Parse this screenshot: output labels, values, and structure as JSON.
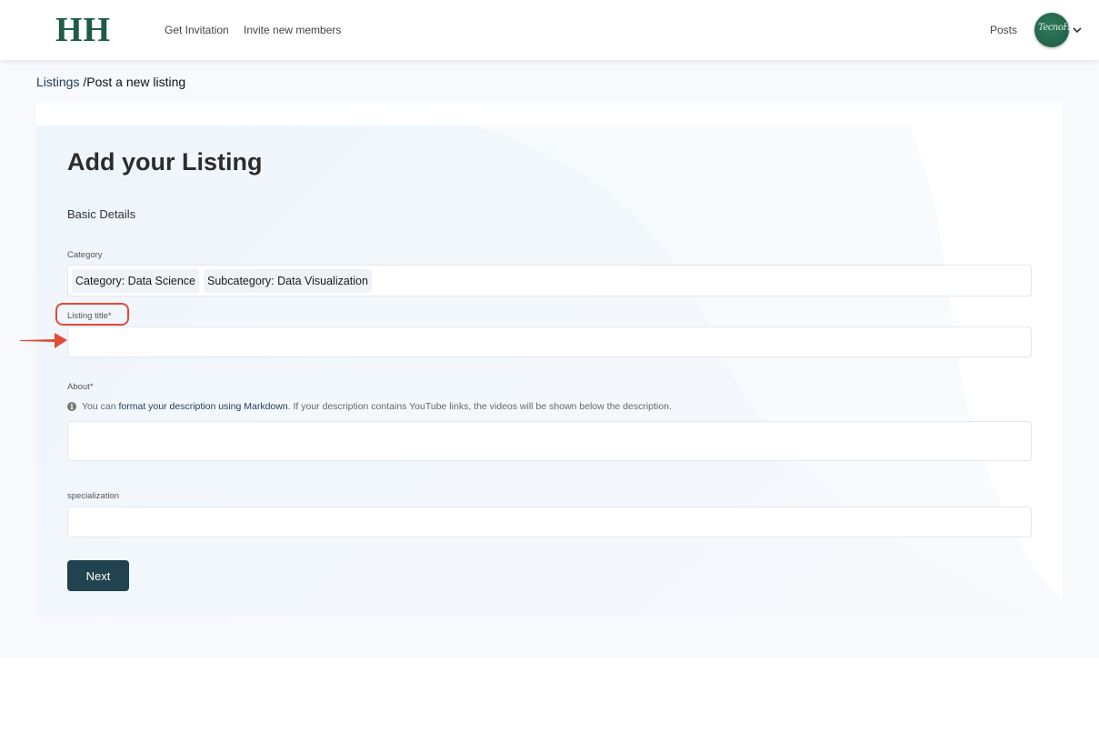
{
  "header": {
    "logo_text": "HH",
    "nav": [
      {
        "label": "Get Invitation"
      },
      {
        "label": "Invite new members"
      }
    ],
    "posts_label": "Posts",
    "avatar_text": "TecnoHub"
  },
  "breadcrumb": {
    "parent": "Listings",
    "separator": " /",
    "current": "Post a new listing"
  },
  "form": {
    "title": "Add your Listing",
    "section": "Basic Details",
    "category": {
      "label": "Category",
      "chips": [
        "Category: Data Science",
        "Subcategory: Data Visualization"
      ]
    },
    "listing_title": {
      "label": "Listing title*",
      "value": ""
    },
    "about": {
      "label": "About*",
      "hint_prefix": "You can ",
      "hint_link": "format your description using Markdown",
      "hint_suffix": ". If your description contains YouTube links, the videos will be shown below the description.",
      "value": ""
    },
    "specialization": {
      "label": "specialization",
      "value": ""
    },
    "next_label": "Next"
  },
  "colors": {
    "brand": "#1f5c45",
    "button": "#21424f",
    "annotation": "#e04b3a"
  },
  "icons": [
    "info-icon",
    "chevron-down-icon"
  ]
}
